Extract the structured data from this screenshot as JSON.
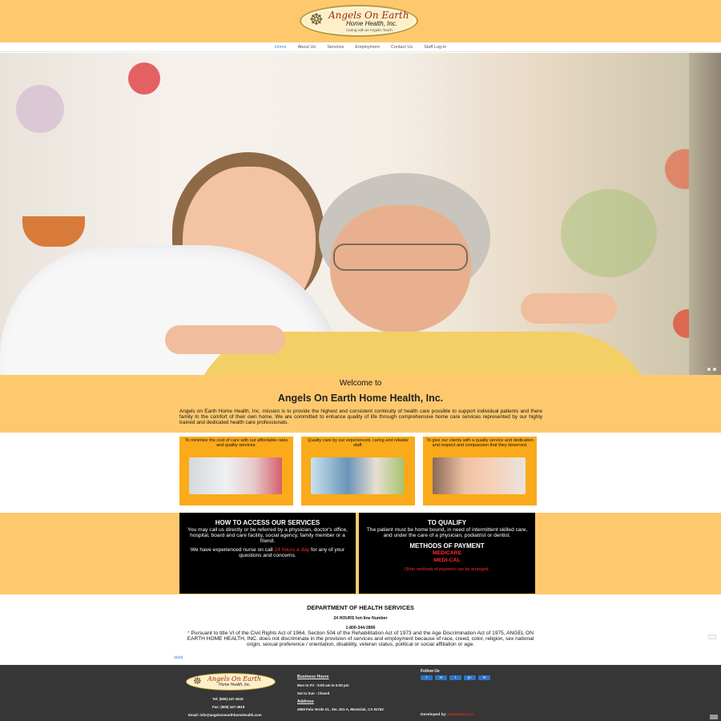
{
  "header": {
    "logo": {
      "brand": "Angels On Earth",
      "subtitle": "Home Health, Inc.",
      "tagline": "Caring with an Angelic Touch"
    }
  },
  "nav": {
    "items": [
      {
        "label": "Home"
      },
      {
        "label": "About Us"
      },
      {
        "label": "Services"
      },
      {
        "label": "Employment"
      },
      {
        "label": "Contact Us"
      },
      {
        "label": "Staff Log-in"
      }
    ],
    "active_index": 0,
    "active_color": "#3a8cd6"
  },
  "welcome": {
    "kicker": "Welcome to",
    "title": "Angels On Earth Home Health, Inc.",
    "body": "Angels on Earth Home Health, Inc. mission is to provide the highest and consistent continuity of health care possible to support individual patients and there family In the comfort of their own home. We are committed to enhance quality of life through comprehensive home care services represented by our highly trained and dedicated health care professionals."
  },
  "cards": [
    {
      "text": "To minimize the cost of care with our affordable rates and quality services."
    },
    {
      "text": "Quality care by our experienced, caring and reliable staff."
    },
    {
      "text": "To give our clients with a quality service and dedication and respect and compassion that they deserved."
    }
  ],
  "access": {
    "title": "HOW TO ACCESS OUR SERVICES",
    "body": "You may call us directly or be referred by a physician, doctor's office, hospital, board and care facility, social agency, family member or a friend.",
    "nurse_pre": "We have experienced nurse on call ",
    "nurse_highlight": "24 hours a day",
    "nurse_post": " for any of your questions and concerns."
  },
  "qualify": {
    "title": "TO QUALIFY",
    "body": "The patient must be home bound, in need of intermittent skilled care, and under the care of a physician, podiatrist or dentist.",
    "payment_title": "METHODS OF PAYMENT",
    "methods": [
      "MEDICARE",
      "MEDI-CAL"
    ],
    "other": "Other methods of payment can be arranged."
  },
  "department": {
    "title": "DEPARTMENT OF HEALTH SERVICES",
    "hotline_label": "24 HOURS hot-line Number",
    "hotline_number": "1-800-344-2896",
    "star": "*",
    "notice": "Pursuant to title VI of the Civil Rights Act of 1964, Section 504 of the Rehabilitation Act of 1973 and the Age Discrimination Act of 1975, ANGEL ON EARTH HOME HEALTH, INC. does not discriminate in the provision of services and employment because of race, creed, color, religion, sex national origin, sexual preference / orientation, disability, veteran status, political or social affiliation or age.",
    "lang_link": "(Edit)"
  },
  "footer": {
    "tel": "Tel: (909) 447-4615",
    "fax": "Fax: (909) 447-4619",
    "email": "Email: info@angelsonearthhomehealth.com",
    "hours_title": "Business Hours",
    "hours_weekday": "Mon to Fri - 9:00 am to 5:00 pm",
    "hours_weekend": "Sat to Sun - Closed",
    "address_title": "Address",
    "address": "4959 Palo Verde St., Ste. 201-A, Montclair, CA 91763",
    "follow_title": "Follow Us",
    "social": [
      {
        "label": "f",
        "icon": "facebook-icon"
      },
      {
        "label": "✉",
        "icon": "mail-icon"
      },
      {
        "label": "t",
        "icon": "twitter-icon"
      },
      {
        "label": "g+",
        "icon": "googleplus-icon"
      },
      {
        "label": "✉",
        "icon": "email-icon"
      }
    ],
    "developed_by": "Developed by:",
    "developer": "GoGlobal LLC."
  },
  "colors": {
    "band": "#fec96d",
    "card": "#fbaa1a",
    "dark": "#000000",
    "footer": "#363636",
    "highlight_red": "#ff2b2b"
  }
}
